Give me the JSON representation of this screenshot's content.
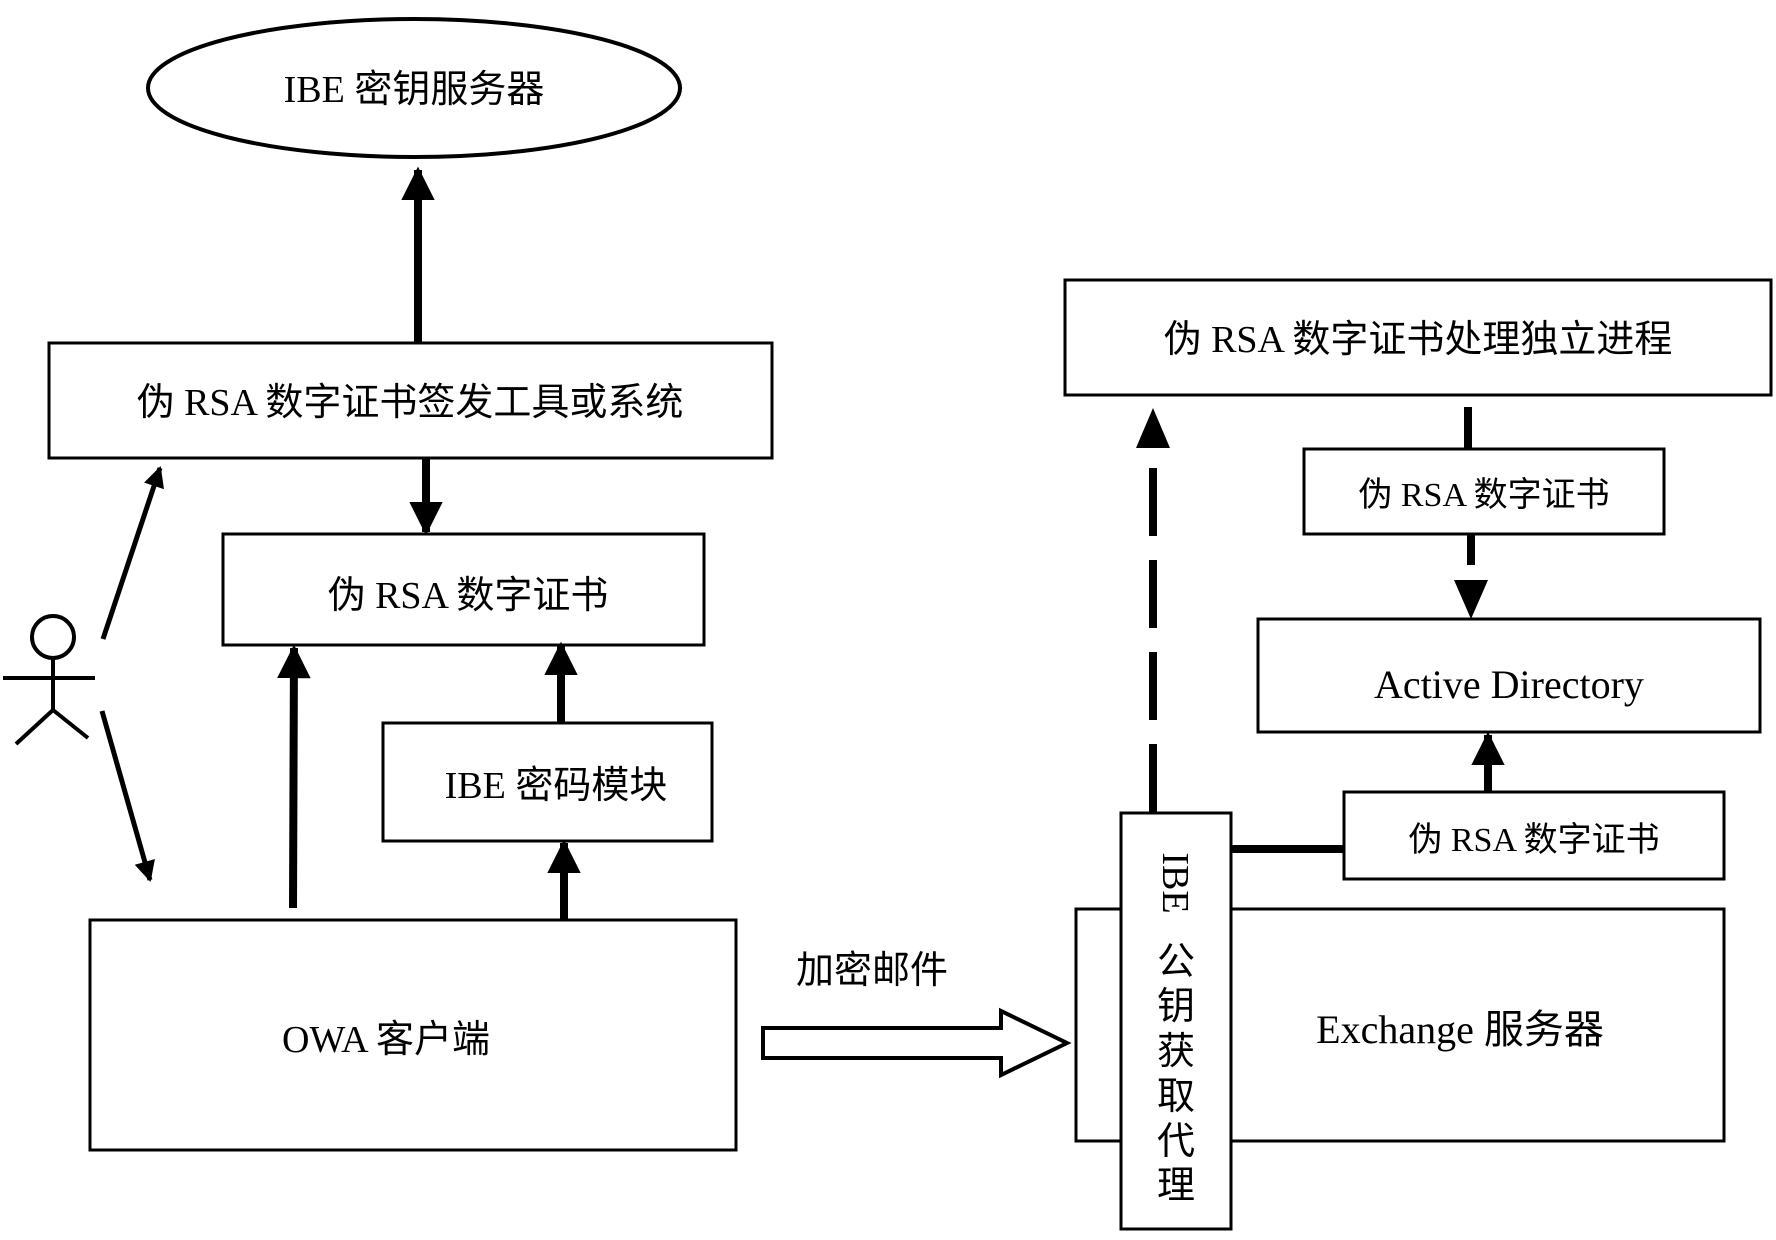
{
  "diagram": {
    "nodes": {
      "ibe_key_server": "IBE 密钥服务器",
      "issuing_tool": "伪 RSA 数字证书签发工具或系统",
      "cert_left": "伪 RSA 数字证书",
      "ibe_crypto_module": "IBE 密码模块",
      "owa_client": "OWA 客户端",
      "independent_process": "伪 RSA 数字证书处理独立进程",
      "cert_right_top": "伪 RSA 数字证书",
      "active_directory": "Active Directory",
      "cert_right_bottom": "伪 RSA 数字证书",
      "exchange_server": "Exchange 服务器",
      "ibe_pubkey_agent": [
        "IBE",
        "公",
        "钥",
        "获",
        "取",
        "代",
        "理"
      ]
    },
    "edges": {
      "encrypted_mail_label": "加密邮件"
    },
    "actor": "user"
  }
}
